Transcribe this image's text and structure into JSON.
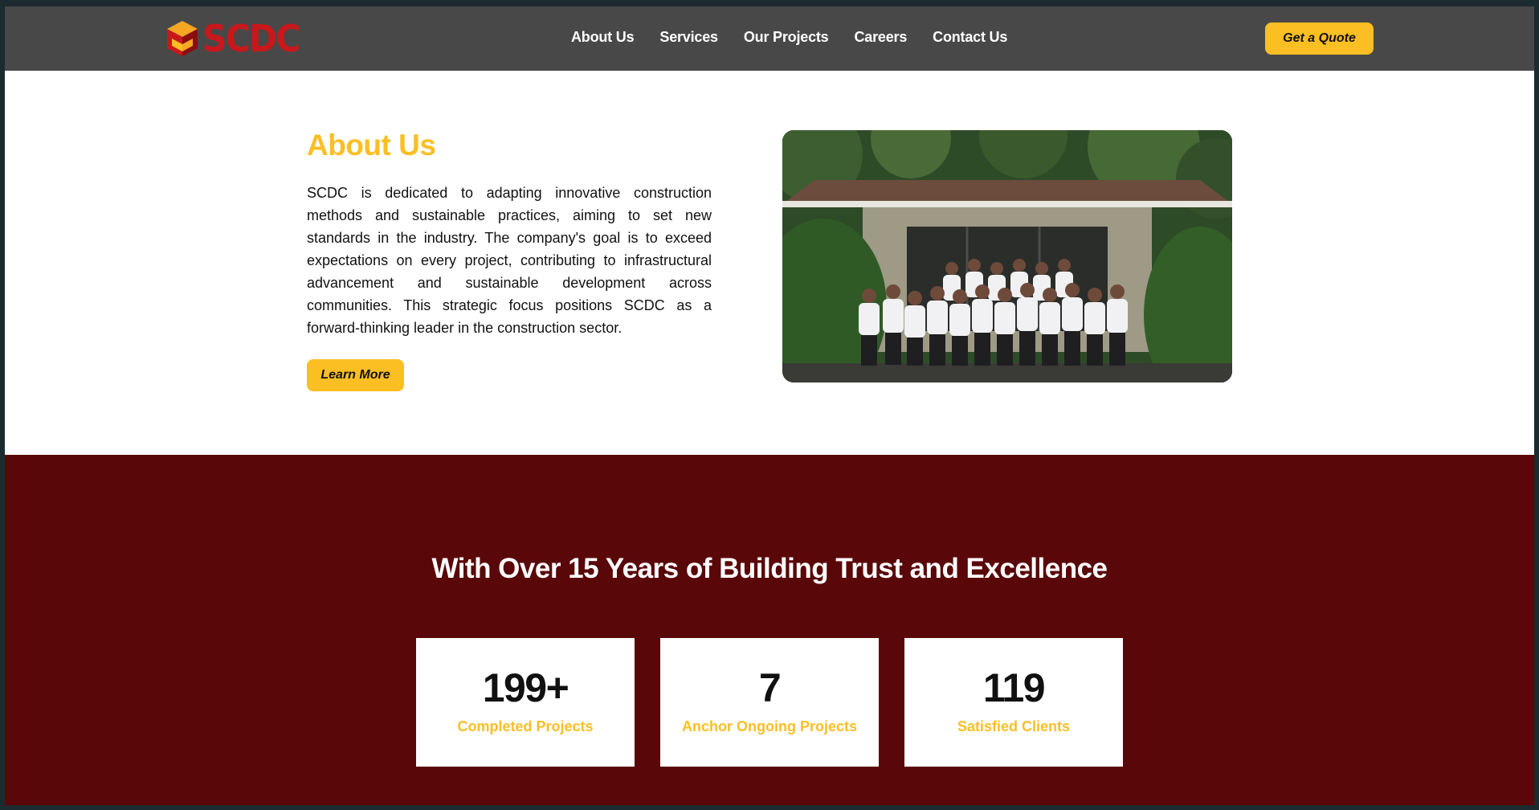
{
  "brand": {
    "logo_text": "SCDC"
  },
  "nav": {
    "items": [
      {
        "label": "About Us"
      },
      {
        "label": "Services"
      },
      {
        "label": "Our Projects"
      },
      {
        "label": "Careers"
      },
      {
        "label": "Contact Us"
      }
    ],
    "quote_button": "Get a Quote"
  },
  "about": {
    "title": "About Us",
    "paragraph": "SCDC is dedicated to adapting innovative construction methods and sustainable practices, aiming to set new standards in the industry. The company's goal is to exceed expectations on every project, contributing to infrastructural advancement and sustainable development across communities. This strategic focus positions SCDC as a forward-thinking leader in the construction sector.",
    "button": "Learn More"
  },
  "stats": {
    "title": "With Over 15 Years of Building Trust and Excellence",
    "items": [
      {
        "value": "199+",
        "label": "Completed Projects"
      },
      {
        "value": "7",
        "label": "Anchor Ongoing Projects"
      },
      {
        "value": "119",
        "label": "Satisfied Clients"
      }
    ]
  },
  "colors": {
    "accent": "#fbbf24",
    "brand_red": "#c8181b",
    "header_bg": "#484848",
    "stats_bg": "#5a0709"
  }
}
